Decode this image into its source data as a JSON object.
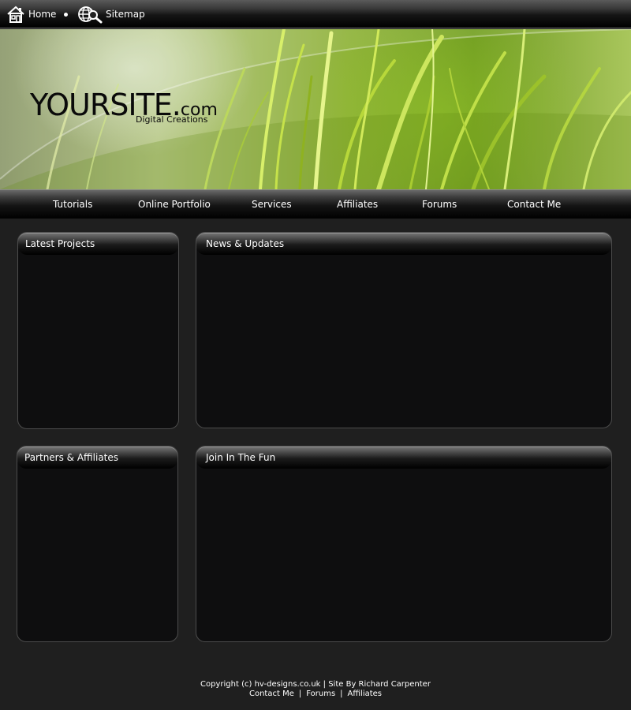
{
  "topbar": {
    "home_label": "Home",
    "sitemap_label": "Sitemap"
  },
  "header": {
    "logo_main": "YOURSITE.",
    "logo_suffix": "com",
    "tagline": "Digital Creations"
  },
  "nav": {
    "items": [
      {
        "label": "Tutorials"
      },
      {
        "label": "Online Portfolio"
      },
      {
        "label": "Services"
      },
      {
        "label": "Affiliates"
      },
      {
        "label": "Forums"
      },
      {
        "label": "Contact Me"
      }
    ]
  },
  "boxes": {
    "latest_projects": "Latest Projects",
    "news_updates": "News & Updates",
    "partners_affiliates": "Partners & Affiliates",
    "join_in": "Join In The Fun"
  },
  "footer": {
    "copyright": "Copyright (c) hv-designs.co.uk | Site By Richard Carpenter",
    "links": [
      "Contact Me",
      "Forums",
      "Affiliates"
    ],
    "separator": "|"
  },
  "colors": {
    "page_background": "#1f1f1f",
    "box_background": "#0e0e0f",
    "accent_green": "#8fb23a"
  }
}
